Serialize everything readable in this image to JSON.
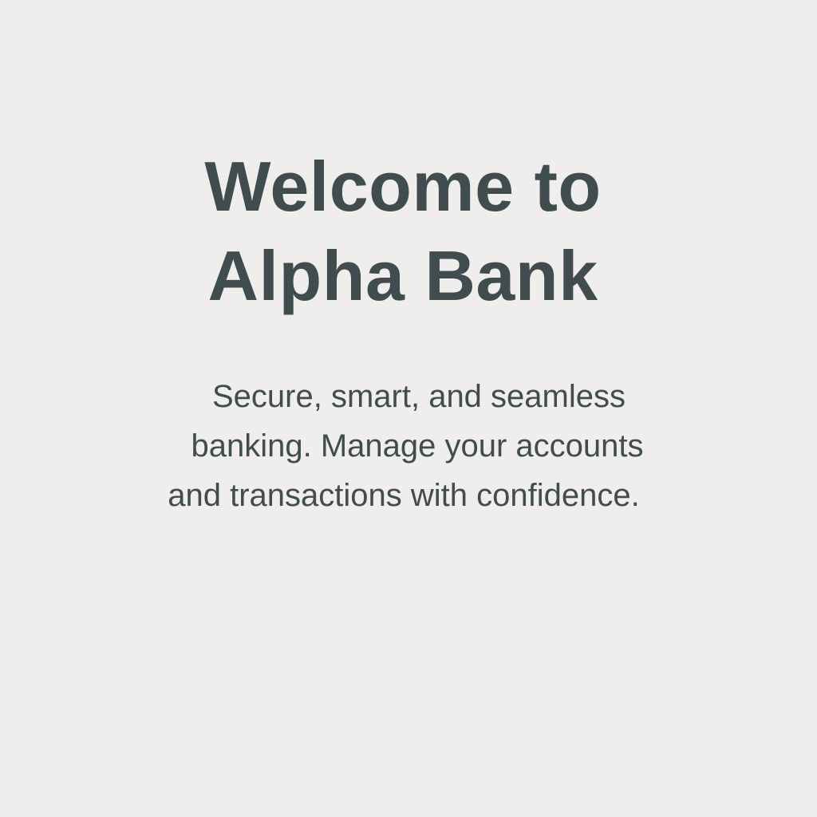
{
  "hero": {
    "title_lines": [
      "Welcome to",
      "Alpha Bank"
    ],
    "subtitle_lines": [
      "Secure, smart, and seamless",
      "banking. Manage your accounts",
      "and transactions with confidence."
    ]
  },
  "colors": {
    "background": "#efeeec",
    "text": "#414c4f"
  }
}
